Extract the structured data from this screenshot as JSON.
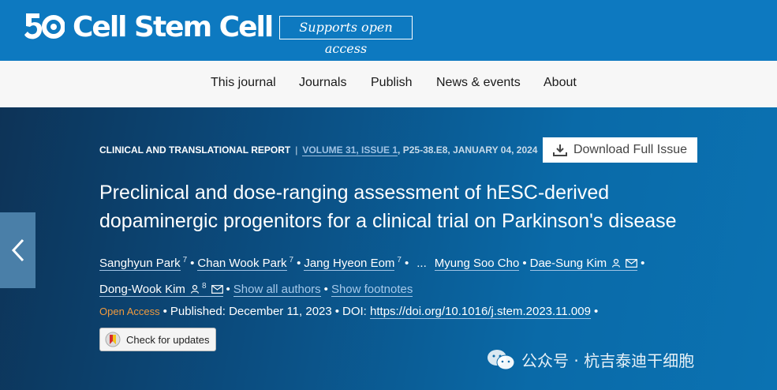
{
  "brand": {
    "logo_number": "50",
    "journal_name": "Cell Stem Cell",
    "open_access_badge": "Supports open access",
    "color": "#0d79c0"
  },
  "nav": {
    "items": [
      "This journal",
      "Journals",
      "Publish",
      "News & events",
      "About"
    ]
  },
  "article": {
    "type": "CLINICAL AND TRANSLATIONAL REPORT",
    "volume": "VOLUME 31, ISSUE 1",
    "pages_date": "P25-38.E8, JANUARY 04, 2024",
    "download_label": "Download Full Issue",
    "title": "Preclinical and dose-ranging assessment of hESC-derived dopaminergic progenitors for a clinical trial on Parkinson's disease",
    "authors": [
      {
        "name": "Sanghyun Park",
        "sup": "7"
      },
      {
        "name": "Chan Wook Park",
        "sup": "7"
      },
      {
        "name": "Jang Hyeon Eom",
        "sup": "7"
      },
      {
        "name": "Myung Soo Cho",
        "sup": ""
      },
      {
        "name": "Dae-Sung Kim",
        "sup": ""
      },
      {
        "name": "Dong-Wook Kim",
        "sup": "8"
      }
    ],
    "ellipsis": "...",
    "show_all_authors": "Show all authors",
    "show_footnotes": "Show footnotes",
    "open_access": "Open Access",
    "published": "Published: December 11, 2023",
    "doi_label": "DOI:",
    "doi_url": "https://doi.org/10.1016/j.stem.2023.11.009",
    "check_updates": "Check for updates"
  },
  "watermark": {
    "text": "公众号 · 杭吉泰迪干细胞"
  },
  "colors": {
    "hero_dark": "#0d3357",
    "hero_light": "#0b72b2",
    "link": "#a6c9ea",
    "open_access": "#f09a3e"
  }
}
